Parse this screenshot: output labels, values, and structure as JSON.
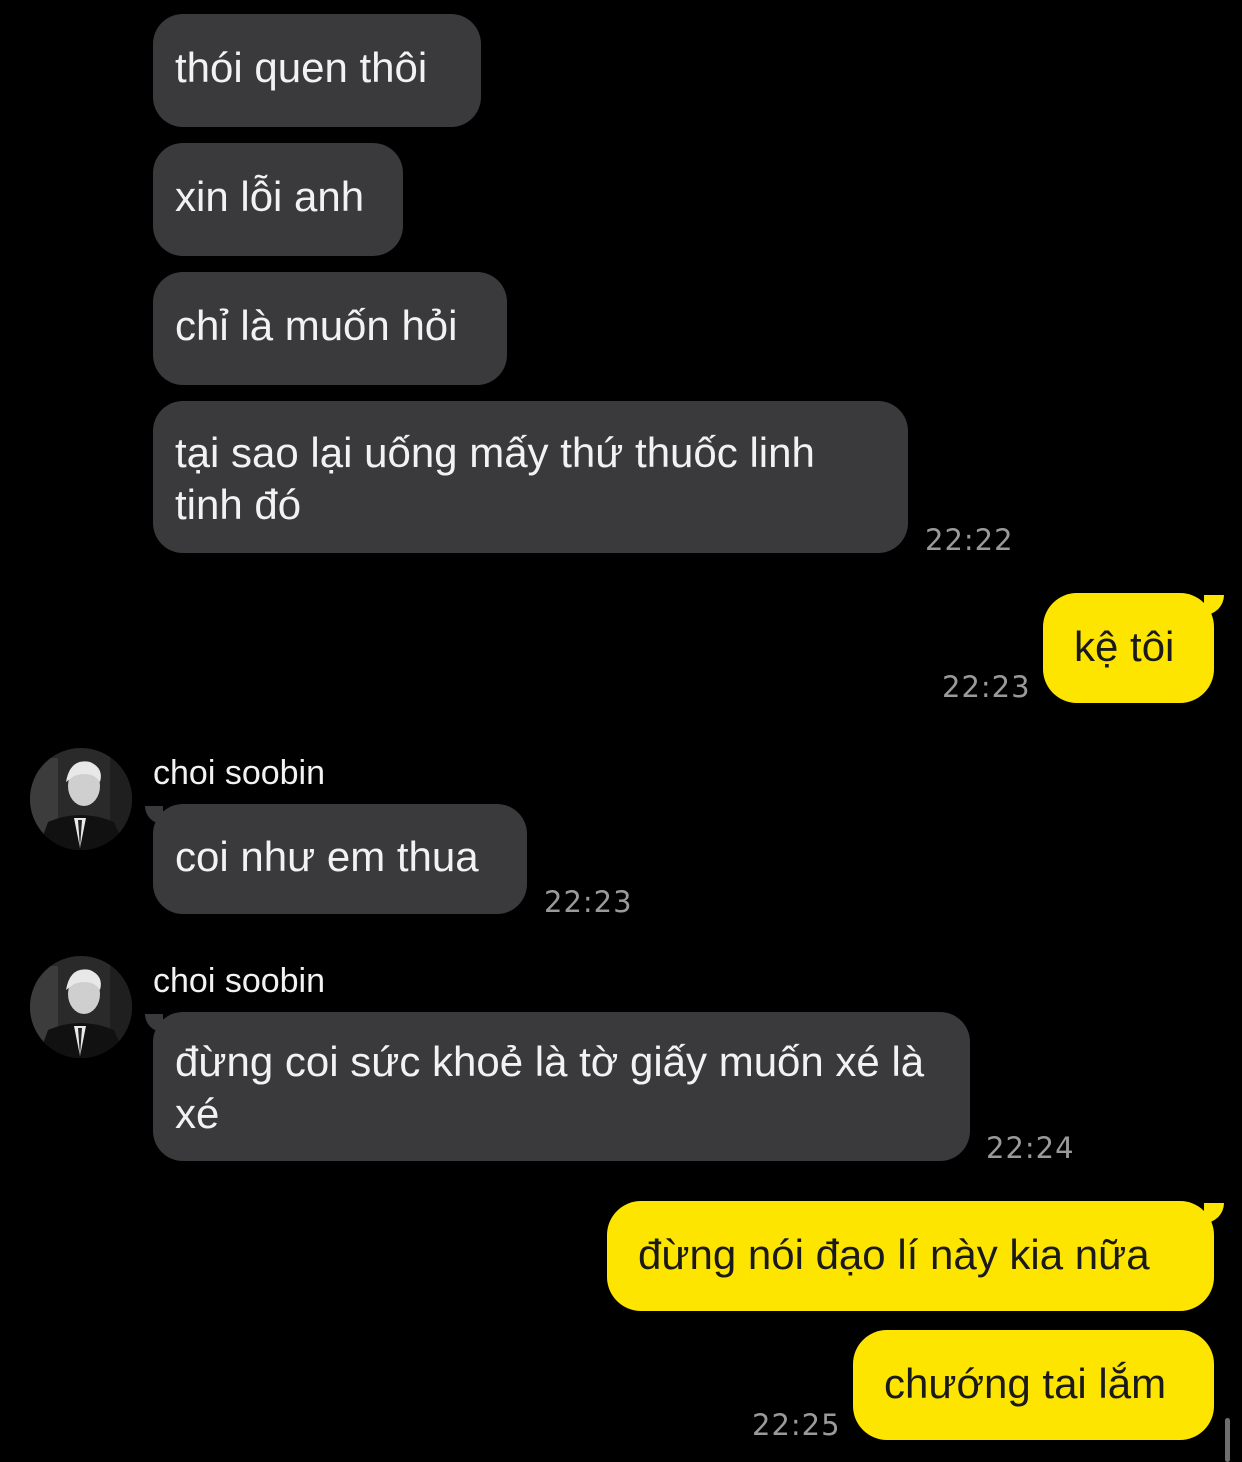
{
  "messages": [
    {
      "text": "thói quen thôi"
    },
    {
      "text": "xin lỗi anh"
    },
    {
      "text": "chỉ là muốn hỏi"
    },
    {
      "text": "tại sao lại uống mấy thứ thuốc linh tinh đó",
      "time": "22:22"
    },
    {
      "text": "kệ tôi",
      "time": "22:23"
    },
    {
      "sender": "choi soobin",
      "text": "coi như em thua",
      "time": "22:23"
    },
    {
      "sender": "choi soobin",
      "text": "đừng coi sức khoẻ là tờ giấy muốn xé là xé",
      "time": "22:24"
    },
    {
      "text": "đừng nói đạo lí này kia nữa"
    },
    {
      "text": "chướng tai lắm",
      "time": "22:25"
    }
  ],
  "icons": {
    "avatar": "profile-avatar-icon"
  },
  "colors": {
    "background": "#000000",
    "incoming": "#3a3a3c",
    "outgoing": "#fee500"
  }
}
